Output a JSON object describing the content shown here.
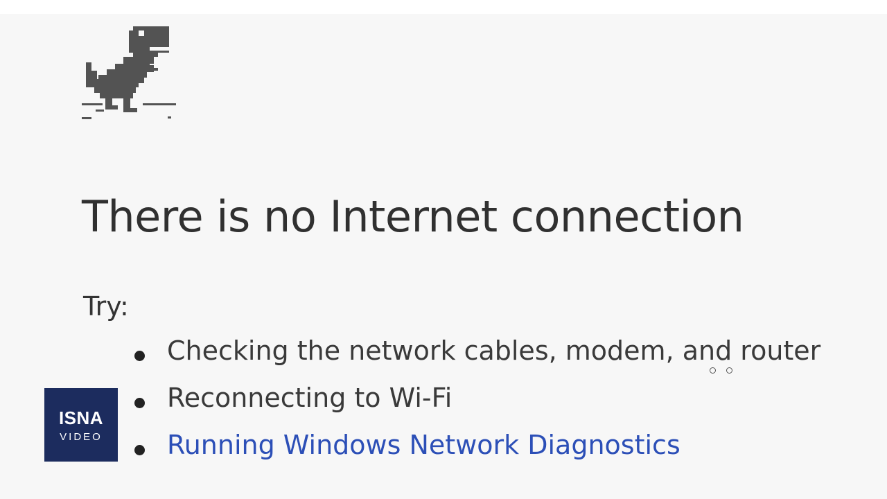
{
  "page": {
    "background_color": "#f7f7f7",
    "dino_icon": "offline-dinosaur-icon"
  },
  "error": {
    "title": "There is no Internet connection",
    "try_label": "Try:",
    "suggestions": [
      {
        "text": "Checking the network cables, modem, and router",
        "is_link": false
      },
      {
        "text": "Reconnecting to Wi-Fi",
        "is_link": false
      },
      {
        "text": "Running Windows Network Diagnostics",
        "is_link": true
      }
    ],
    "link_color": "#2c4fb7"
  },
  "watermark": {
    "line1": "ISNA",
    "line2": "VIDEO",
    "background_color": "#1c2c5e"
  }
}
